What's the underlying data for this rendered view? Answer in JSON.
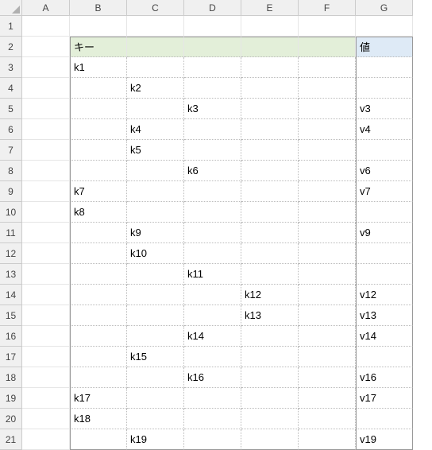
{
  "columns": [
    "A",
    "B",
    "C",
    "D",
    "E",
    "F",
    "G"
  ],
  "rowCount": 21,
  "headers": {
    "key": "キー",
    "value": "値"
  },
  "dataRows": [
    {
      "b": "k1",
      "c": "",
      "d": "",
      "e": "",
      "g": ""
    },
    {
      "b": "",
      "c": "k2",
      "d": "",
      "e": "",
      "g": ""
    },
    {
      "b": "",
      "c": "",
      "d": "k3",
      "e": "",
      "g": "v3"
    },
    {
      "b": "",
      "c": "k4",
      "d": "",
      "e": "",
      "g": "v4"
    },
    {
      "b": "",
      "c": "k5",
      "d": "",
      "e": "",
      "g": ""
    },
    {
      "b": "",
      "c": "",
      "d": "k6",
      "e": "",
      "g": "v6"
    },
    {
      "b": "k7",
      "c": "",
      "d": "",
      "e": "",
      "g": "v7"
    },
    {
      "b": "k8",
      "c": "",
      "d": "",
      "e": "",
      "g": ""
    },
    {
      "b": "",
      "c": "k9",
      "d": "",
      "e": "",
      "g": "v9"
    },
    {
      "b": "",
      "c": "k10",
      "d": "",
      "e": "",
      "g": ""
    },
    {
      "b": "",
      "c": "",
      "d": "k11",
      "e": "",
      "g": ""
    },
    {
      "b": "",
      "c": "",
      "d": "",
      "e": "k12",
      "g": "v12"
    },
    {
      "b": "",
      "c": "",
      "d": "",
      "e": "k13",
      "g": "v13"
    },
    {
      "b": "",
      "c": "",
      "d": "k14",
      "e": "",
      "g": "v14"
    },
    {
      "b": "",
      "c": "k15",
      "d": "",
      "e": "",
      "g": ""
    },
    {
      "b": "",
      "c": "",
      "d": "k16",
      "e": "",
      "g": "v16"
    },
    {
      "b": "k17",
      "c": "",
      "d": "",
      "e": "",
      "g": "v17"
    },
    {
      "b": "k18",
      "c": "",
      "d": "",
      "e": "",
      "g": ""
    },
    {
      "b": "",
      "c": "k19",
      "d": "",
      "e": "",
      "g": "v19"
    }
  ]
}
